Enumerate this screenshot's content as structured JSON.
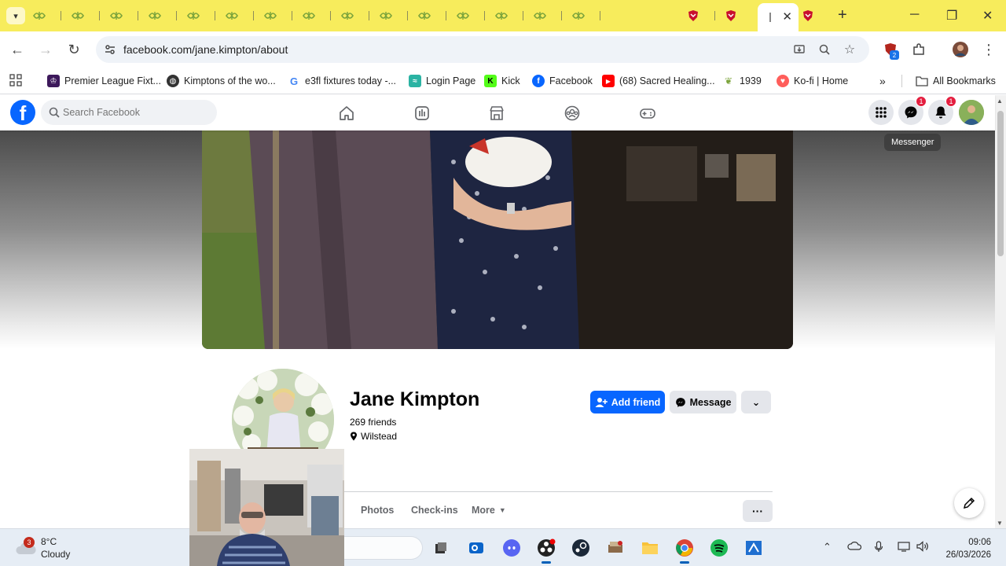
{
  "browser": {
    "url": "facebook.com/jane.kimpton/about",
    "tab_count_inactive": 15,
    "bookmarks": [
      {
        "label": "Premier League Fixt...",
        "icon": "premier-league-icon"
      },
      {
        "label": "Kimptons of the wo...",
        "icon": "globe-icon"
      },
      {
        "label": "e3fl fixtures today -...",
        "icon": "google-icon"
      },
      {
        "label": "Login Page",
        "icon": "login-page-icon"
      },
      {
        "label": "Kick",
        "icon": "kick-icon"
      },
      {
        "label": "Facebook",
        "icon": "facebook-icon"
      },
      {
        "label": "(68) Sacred Healing...",
        "icon": "youtube-icon"
      },
      {
        "label": "1939",
        "icon": "ancestry-icon"
      },
      {
        "label": "Ko-fi | Home",
        "icon": "kofi-icon"
      }
    ],
    "all_bookmarks": "All Bookmarks",
    "extension_badge": "2"
  },
  "facebook": {
    "search_placeholder": "Search Facebook",
    "messenger_badge": "1",
    "notifications_badge": "1",
    "tooltip": "Messenger",
    "profile": {
      "name": "Jane Kimpton",
      "friends": "269 friends",
      "location": "Wilstead"
    },
    "buttons": {
      "add_friend": "Add friend",
      "message": "Message"
    },
    "tabs": [
      "Photos",
      "Check-ins",
      "More"
    ],
    "colors": {
      "brand": "#0866ff",
      "badge": "#e41e3f"
    }
  },
  "taskbar": {
    "weather_badge": "3",
    "temperature": "8°C",
    "condition": "Cloudy",
    "time": "09:06",
    "date": "26/03/2026"
  }
}
